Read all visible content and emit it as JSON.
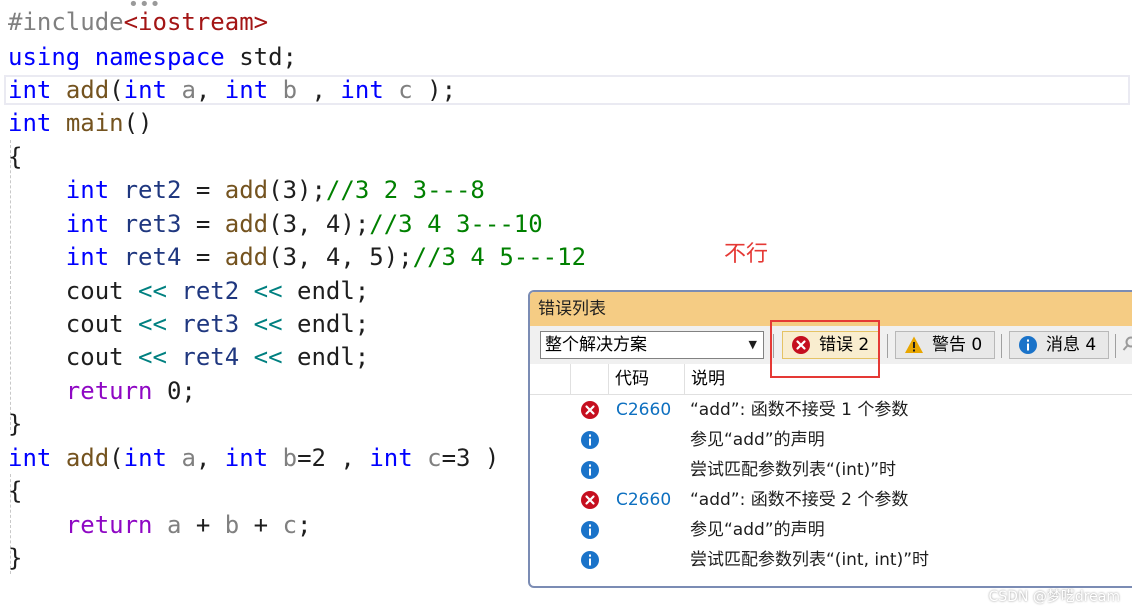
{
  "editor": {
    "collapsed_marker": "•••",
    "lines": [
      [
        {
          "t": "#include",
          "c": "pp"
        },
        {
          "t": "<iostream>",
          "c": "inc"
        }
      ],
      [
        {
          "t": "using",
          "c": "kw"
        },
        {
          "t": " "
        },
        {
          "t": "namespace",
          "c": "kw"
        },
        {
          "t": " std;"
        }
      ],
      [
        {
          "t": "int",
          "c": "kw"
        },
        {
          "t": " "
        },
        {
          "t": "add",
          "c": "fn"
        },
        {
          "t": "("
        },
        {
          "t": "int",
          "c": "kw"
        },
        {
          "t": " "
        },
        {
          "t": "a",
          "c": "param"
        },
        {
          "t": ", "
        },
        {
          "t": "int",
          "c": "kw"
        },
        {
          "t": " "
        },
        {
          "t": "b",
          "c": "param"
        },
        {
          "t": " , "
        },
        {
          "t": "int",
          "c": "kw"
        },
        {
          "t": " "
        },
        {
          "t": "c",
          "c": "param"
        },
        {
          "t": " );"
        }
      ],
      [
        {
          "t": "int",
          "c": "kw"
        },
        {
          "t": " "
        },
        {
          "t": "main",
          "c": "fn"
        },
        {
          "t": "()"
        }
      ],
      [
        {
          "t": "{"
        }
      ],
      [
        {
          "t": "    "
        },
        {
          "t": "int",
          "c": "kw"
        },
        {
          "t": " "
        },
        {
          "t": "ret2",
          "c": "var"
        },
        {
          "t": " = "
        },
        {
          "t": "add",
          "c": "fn"
        },
        {
          "t": "(3);"
        },
        {
          "t": "//3 2 3---8",
          "c": "cm"
        }
      ],
      [
        {
          "t": "    "
        },
        {
          "t": "int",
          "c": "kw"
        },
        {
          "t": " "
        },
        {
          "t": "ret3",
          "c": "var"
        },
        {
          "t": " = "
        },
        {
          "t": "add",
          "c": "fn"
        },
        {
          "t": "(3, 4);"
        },
        {
          "t": "//3 4 3---10",
          "c": "cm"
        }
      ],
      [
        {
          "t": "    "
        },
        {
          "t": "int",
          "c": "kw"
        },
        {
          "t": " "
        },
        {
          "t": "ret4",
          "c": "var"
        },
        {
          "t": " = "
        },
        {
          "t": "add",
          "c": "fn"
        },
        {
          "t": "(3, 4, 5);"
        },
        {
          "t": "//3 4 5---12",
          "c": "cm"
        }
      ],
      [
        {
          "t": "    cout "
        },
        {
          "t": "<<",
          "c": "op"
        },
        {
          "t": " "
        },
        {
          "t": "ret2",
          "c": "var"
        },
        {
          "t": " "
        },
        {
          "t": "<<",
          "c": "op"
        },
        {
          "t": " endl;"
        }
      ],
      [
        {
          "t": "    cout "
        },
        {
          "t": "<<",
          "c": "op"
        },
        {
          "t": " "
        },
        {
          "t": "ret3",
          "c": "var"
        },
        {
          "t": " "
        },
        {
          "t": "<<",
          "c": "op"
        },
        {
          "t": " endl;"
        }
      ],
      [
        {
          "t": "    cout "
        },
        {
          "t": "<<",
          "c": "op"
        },
        {
          "t": " "
        },
        {
          "t": "ret4",
          "c": "var"
        },
        {
          "t": " "
        },
        {
          "t": "<<",
          "c": "op"
        },
        {
          "t": " endl;"
        }
      ],
      [
        {
          "t": "    "
        },
        {
          "t": "return",
          "c": "kw2"
        },
        {
          "t": " 0;"
        }
      ],
      [
        {
          "t": "}"
        }
      ],
      [
        {
          "t": "int",
          "c": "kw"
        },
        {
          "t": " "
        },
        {
          "t": "add",
          "c": "fn"
        },
        {
          "t": "("
        },
        {
          "t": "int",
          "c": "kw"
        },
        {
          "t": " "
        },
        {
          "t": "a",
          "c": "param"
        },
        {
          "t": ", "
        },
        {
          "t": "int",
          "c": "kw"
        },
        {
          "t": " "
        },
        {
          "t": "b",
          "c": "param"
        },
        {
          "t": "=2 , "
        },
        {
          "t": "int",
          "c": "kw"
        },
        {
          "t": " "
        },
        {
          "t": "c",
          "c": "param"
        },
        {
          "t": "=3 )"
        }
      ],
      [
        {
          "t": "{"
        }
      ],
      [
        {
          "t": "    "
        },
        {
          "t": "return",
          "c": "kw2"
        },
        {
          "t": " "
        },
        {
          "t": "a",
          "c": "param"
        },
        {
          "t": " + "
        },
        {
          "t": "b",
          "c": "param"
        },
        {
          "t": " + "
        },
        {
          "t": "c",
          "c": "param"
        },
        {
          "t": ";"
        }
      ],
      [
        {
          "t": "}"
        }
      ]
    ]
  },
  "annotation": {
    "text": "不行",
    "color": "#e53935"
  },
  "error_list": {
    "title": "错误列表",
    "scope": "整个解决方案",
    "errors_button": "错误 2",
    "warnings_button": "警告 0",
    "messages_button": "消息 4",
    "columns": {
      "code": "代码",
      "description": "说明"
    },
    "rows": [
      {
        "icon": "error-icon",
        "code": "C2660",
        "description": "“add”: 函数不接受 1 个参数"
      },
      {
        "icon": "info-icon",
        "code": "",
        "description": "参见“add”的声明"
      },
      {
        "icon": "info-icon",
        "code": "",
        "description": "尝试匹配参数列表“(int)”时"
      },
      {
        "icon": "error-icon",
        "code": "C2660",
        "description": "“add”: 函数不接受 2 个参数"
      },
      {
        "icon": "info-icon",
        "code": "",
        "description": "参见“add”的声明"
      },
      {
        "icon": "info-icon",
        "code": "",
        "description": "尝试匹配参数列表“(int, int)”时"
      }
    ]
  },
  "watermark": "CSDN @梦呓dream",
  "colors": {
    "title_bar": "#f5cc84",
    "error": "#c50f1f",
    "info": "#1a73c9",
    "warning": "#e8a600"
  }
}
